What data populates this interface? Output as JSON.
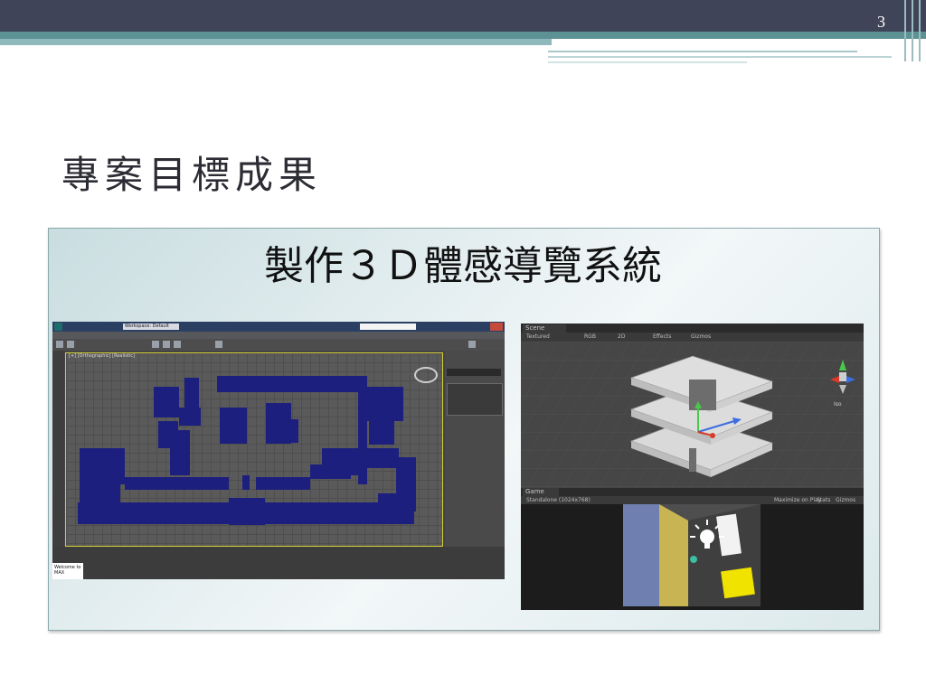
{
  "slide": {
    "page_number": "3",
    "title": "專案目標成果",
    "heading": "製作３Ｄ體感導覽系統"
  },
  "modeling_app": {
    "workspace_label": "Workspace: Default",
    "viewport_label": "[+] [Orthographic] [Realistic]",
    "welcome_text": "Welcome to MAX",
    "block_color": "#1d1f7e"
  },
  "unity_editor": {
    "scene_tab": "Scene",
    "scene_mode": "Textured",
    "scene_rgb": "RGB",
    "scene_2d": "2D",
    "scene_effects": "Effects",
    "scene_gizmos": "Gizmos",
    "iso_label": "Iso",
    "game_tab": "Game",
    "game_resolution": "Standalone (1024x768)",
    "maximize_on_play": "Maximize on Play",
    "stats": "Stats",
    "game_gizmos": "Gizmos"
  },
  "colors": {
    "topbar": "#3f4458",
    "accent_teal": "#5d9294",
    "floor_plates": "#d9d9d9",
    "game_blue_wall": "#6f7fb0",
    "game_yellow_wall": "#c9b454",
    "game_yellow_cube": "#f0e300"
  }
}
